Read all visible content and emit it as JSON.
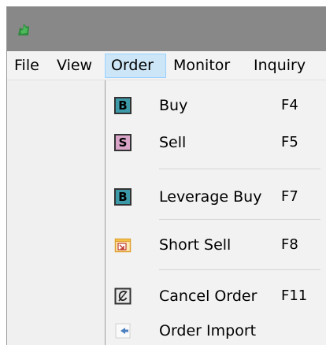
{
  "menubar": {
    "items": [
      "File",
      "View",
      "Order",
      "Monitor",
      "Inquiry"
    ],
    "active_item": "Order"
  },
  "order_menu": {
    "items": [
      {
        "label": "Buy",
        "shortcut": "F4",
        "icon": "buy-icon",
        "icon_letter": "B",
        "icon_color": "#3c9aa8"
      },
      {
        "label": "Sell",
        "shortcut": "F5",
        "icon": "sell-icon",
        "icon_letter": "S",
        "icon_color": "#d9a4c8"
      },
      {
        "label": "Leverage Buy",
        "shortcut": "F7",
        "icon": "leverage-buy-icon",
        "icon_letter": "B",
        "icon_color": "#3c9aa8"
      },
      {
        "label": "Short Sell",
        "shortcut": "F8",
        "icon": "short-sell-icon"
      },
      {
        "label": "Cancel Order",
        "shortcut": "F11",
        "icon": "cancel-order-icon"
      },
      {
        "label": "Order Import",
        "shortcut": "",
        "icon": "order-import-icon"
      }
    ]
  },
  "colors": {
    "titlebar": "#888888",
    "menu_background": "#f2f2f2",
    "active_menu_highlight": "#cde6f7",
    "active_menu_border": "#99d1ff",
    "app_icon": "#2e8b3e"
  }
}
